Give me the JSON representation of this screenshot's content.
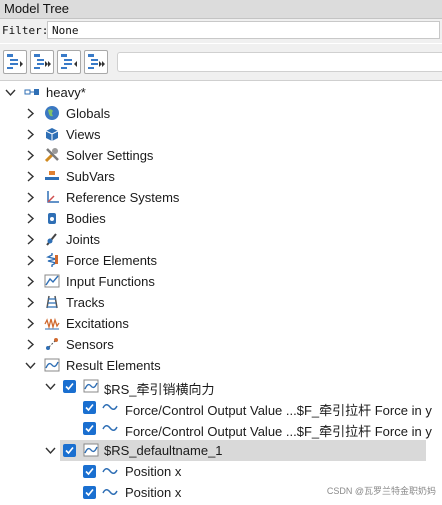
{
  "title": "Model Tree",
  "filter": {
    "label": "Filter:",
    "value": "None"
  },
  "toolbar": {
    "buttons": [
      "collapse-icon",
      "collapse-all-icon",
      "expand-icon",
      "expand-all-icon"
    ]
  },
  "tree": {
    "root": {
      "label": "heavy*",
      "icon": "model-icon"
    },
    "items": [
      {
        "label": "Globals",
        "icon": "globe-icon"
      },
      {
        "label": "Views",
        "icon": "cube-icon"
      },
      {
        "label": "Solver Settings",
        "icon": "wrench-icon"
      },
      {
        "label": "SubVars",
        "icon": "subvars-icon"
      },
      {
        "label": "Reference Systems",
        "icon": "axes-icon"
      },
      {
        "label": "Bodies",
        "icon": "bodies-icon"
      },
      {
        "label": "Joints",
        "icon": "joint-icon"
      },
      {
        "label": "Force Elements",
        "icon": "spring-icon"
      },
      {
        "label": "Input Functions",
        "icon": "function-icon"
      },
      {
        "label": "Tracks",
        "icon": "track-icon"
      },
      {
        "label": "Excitations",
        "icon": "wave-icon"
      },
      {
        "label": "Sensors",
        "icon": "sensor-icon"
      },
      {
        "label": "Result Elements",
        "icon": "result-icon"
      }
    ],
    "result_children": [
      {
        "label": "$RS_牵引销横向力",
        "checked": true,
        "children": [
          {
            "label": "Force/Control Output Value ...$F_牵引拉杆 Force in y",
            "checked": true
          },
          {
            "label": "Force/Control Output Value ...$F_牵引拉杆 Force in y",
            "checked": true
          }
        ]
      },
      {
        "label": "$RS_defaultname_1",
        "checked": true,
        "selected": true,
        "children": [
          {
            "label": "Position x",
            "checked": true
          },
          {
            "label": "Position x",
            "checked": true
          }
        ]
      }
    ]
  },
  "watermark": "CSDN @瓦罗兰特金职奶妈",
  "colors": {
    "checkbox": "#1a6fd0",
    "selection": "#d9d9d9",
    "titlebar": "#dcdcdc"
  }
}
